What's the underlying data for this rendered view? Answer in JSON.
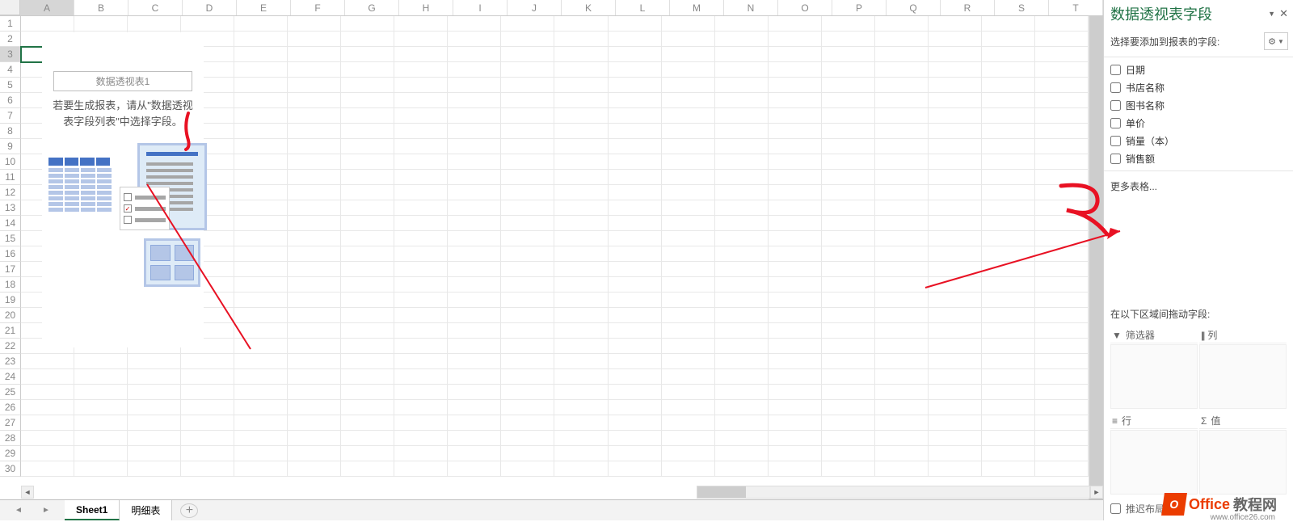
{
  "columns": [
    "A",
    "B",
    "C",
    "D",
    "E",
    "F",
    "G",
    "H",
    "I",
    "J",
    "K",
    "L",
    "M",
    "N",
    "O",
    "P",
    "Q",
    "R",
    "S",
    "T"
  ],
  "row_count": 30,
  "selected_cell": {
    "col": "A",
    "row": 3
  },
  "pivot_placeholder": {
    "title": "数据透视表1",
    "hint": "若要生成报表，请从\"数据透视表字段列表\"中选择字段。"
  },
  "sheet_tabs": {
    "active": "Sheet1",
    "tabs": [
      "Sheet1",
      "明细表"
    ],
    "add_tooltip": "+"
  },
  "side_panel": {
    "title": "数据透视表字段",
    "subtitle": "选择要添加到报表的字段:",
    "fields": [
      "日期",
      "书店名称",
      "图书名称",
      "单价",
      "销量（本）",
      "销售额"
    ],
    "more_tables": "更多表格...",
    "areas_title": "在以下区域间拖动字段:",
    "area_filters": "筛选器",
    "area_columns": "列",
    "area_rows": "行",
    "area_values": "值",
    "defer_label": "推迟布局更新"
  },
  "watermark": {
    "brand1": "Office",
    "brand2": "教程网",
    "url": "www.office26.com"
  }
}
